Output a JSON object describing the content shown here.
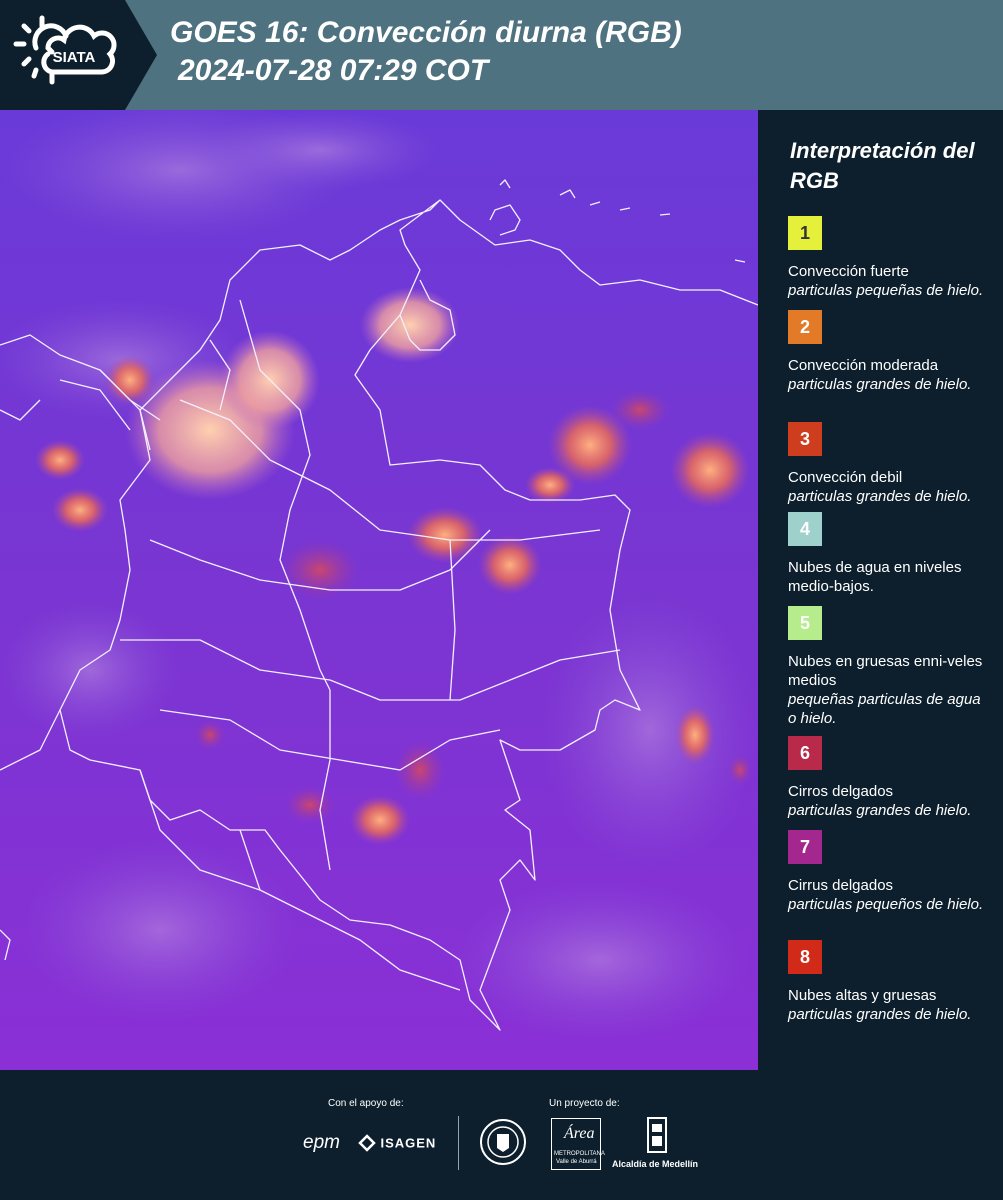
{
  "header": {
    "logo_text": "SIATA",
    "title_line1": "GOES 16: Convección diurna (RGB)",
    "title_line2": "2024-07-28 07:29 COT"
  },
  "legend": {
    "title": "Interpretación del RGB",
    "items": [
      {
        "number": "1",
        "color": "#e5f03a",
        "label": "Convección fuerte",
        "sub": "particulas pequeñas de hielo."
      },
      {
        "number": "2",
        "color": "#e27a28",
        "label": "Convección moderada",
        "sub": "particulas grandes de hielo."
      },
      {
        "number": "3",
        "color": "#cf3d1f",
        "label": "Convección debil",
        "sub": "particulas grandes de hielo."
      },
      {
        "number": "4",
        "color": "#9fd1cc",
        "label": "Nubes de agua en niveles medio-bajos.",
        "sub": ""
      },
      {
        "number": "5",
        "color": "#b6ec8c",
        "label": "Nubes en gruesas enni-veles medios",
        "sub": "pequeñas particulas de agua o hielo."
      },
      {
        "number": "6",
        "color": "#b8294a",
        "label": "Cirros delgados",
        "sub": "particulas grandes de hielo."
      },
      {
        "number": "7",
        "color": "#a3278e",
        "label": "Cirrus delgados",
        "sub": "particulas pequeños de hielo."
      },
      {
        "number": "8",
        "color": "#d22a18",
        "label": "Nubes altas y gruesas",
        "sub": "particulas grandes de hielo."
      }
    ]
  },
  "footer": {
    "support_label": "Con el apoyo de:",
    "project_label": "Un proyecto de:",
    "sponsor1": "epm",
    "sponsor2": "ISAGEN",
    "partner_area": "Área",
    "partner_area_sub1": "METROPOLITANA",
    "partner_area_sub2": "Valle de Aburrá",
    "partner_alcaldia": "Alcaldía de Medellín"
  },
  "colors": {
    "header_bg": "#4f7280",
    "panel_bg": "#0d1f2c",
    "map_base": "#7a2fd9"
  }
}
